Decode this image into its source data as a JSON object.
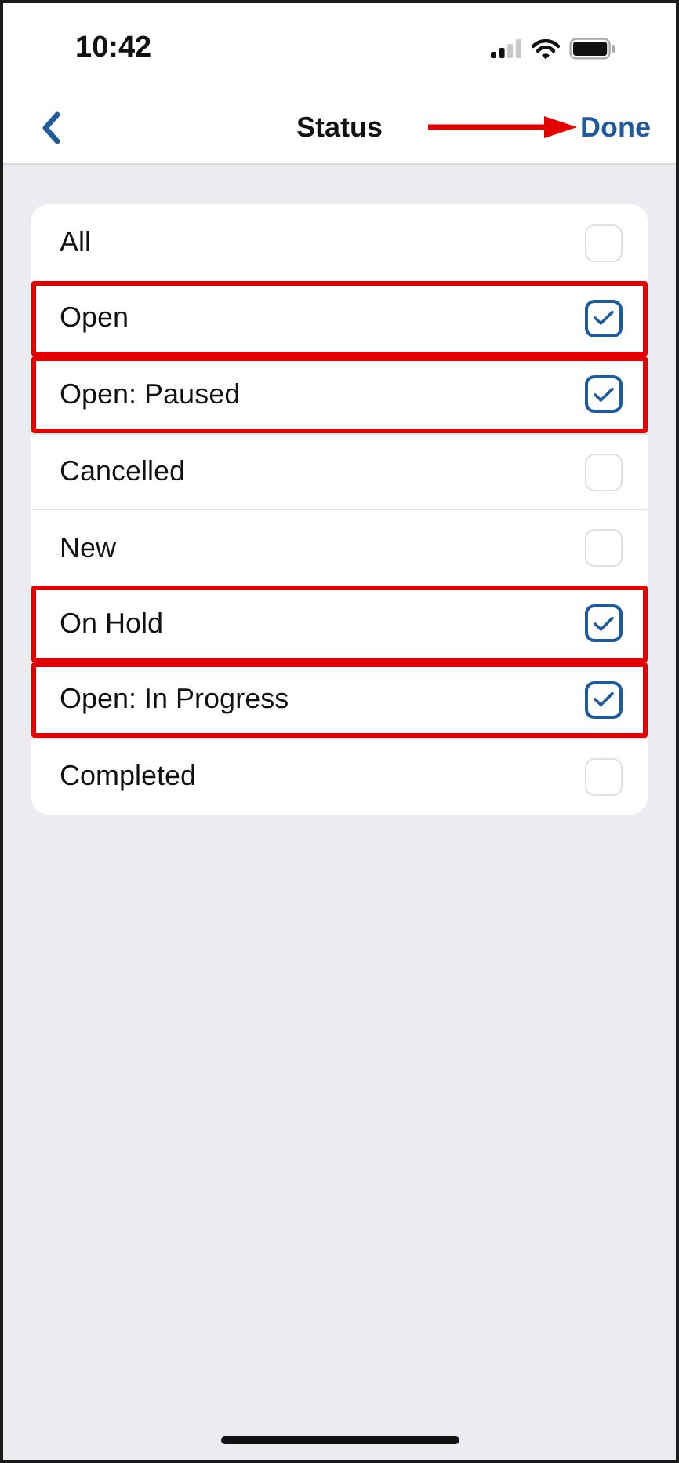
{
  "status_bar": {
    "time": "10:42"
  },
  "nav": {
    "title": "Status",
    "done": "Done"
  },
  "items": [
    {
      "label": "All",
      "checked": false,
      "highlighted": false
    },
    {
      "label": "Open",
      "checked": true,
      "highlighted": true
    },
    {
      "label": "Open: Paused",
      "checked": true,
      "highlighted": true
    },
    {
      "label": "Cancelled",
      "checked": false,
      "highlighted": false
    },
    {
      "label": "New",
      "checked": false,
      "highlighted": false
    },
    {
      "label": "On Hold",
      "checked": true,
      "highlighted": true
    },
    {
      "label": "Open: In Progress",
      "checked": true,
      "highlighted": true
    },
    {
      "label": "Completed",
      "checked": false,
      "highlighted": false
    }
  ]
}
